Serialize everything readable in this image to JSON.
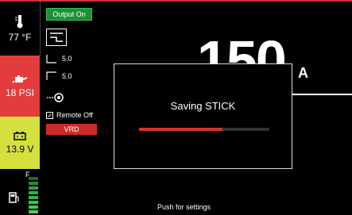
{
  "status": {
    "temperature": "77 °F",
    "pressure": "18 PSI",
    "voltage": "13.9 V",
    "fuel_label": "F"
  },
  "mode_panel": {
    "output_status": "Output On",
    "ramp_up": "5.0",
    "ramp_down": "5.0",
    "remote": "Remote Off",
    "vrd": "VRD"
  },
  "main": {
    "current_value": "150",
    "unit": "A"
  },
  "dialog": {
    "title": "Saving STICK",
    "progress": 0.64
  },
  "footer": {
    "hint": "Push for settings"
  },
  "colors": {
    "alert_red": "#e33c3c",
    "volt_yellow": "#d4e03e",
    "output_green": "#1f8f3a",
    "progress_red": "#d9302f"
  }
}
